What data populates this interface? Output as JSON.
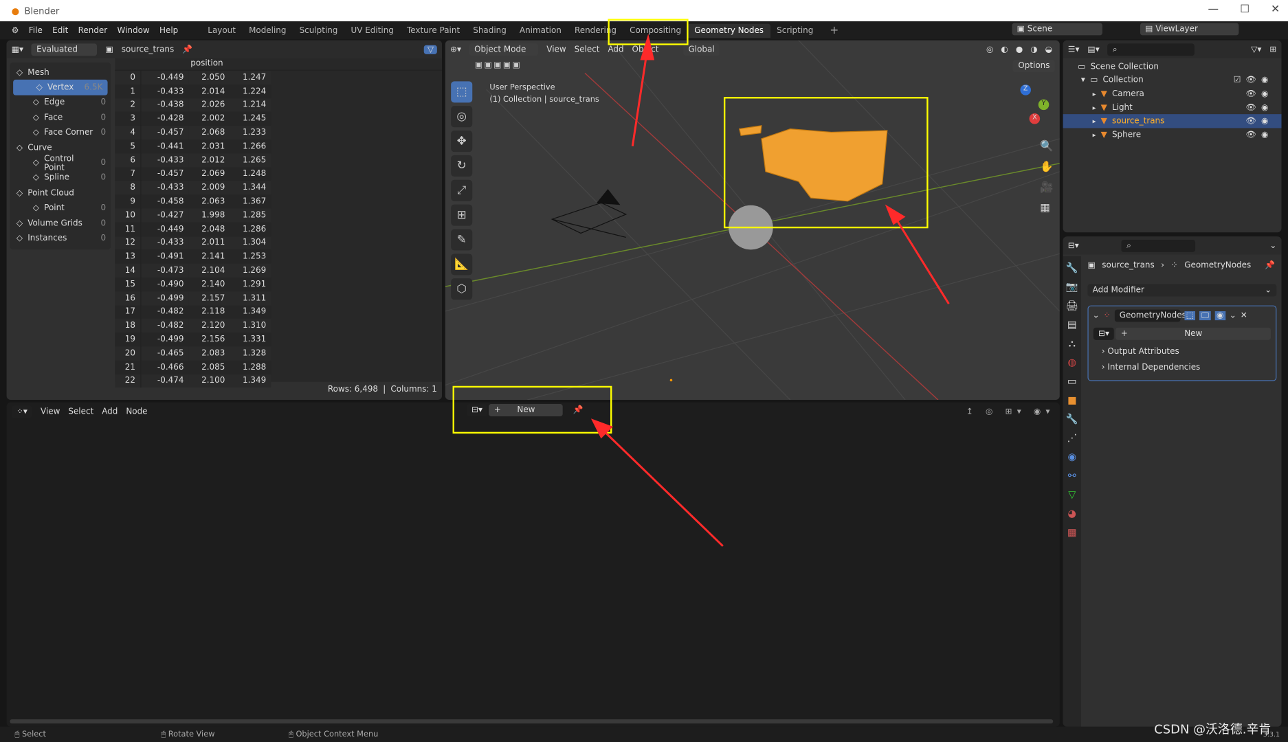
{
  "window": {
    "title": "Blender",
    "min": "—",
    "max": "☐",
    "close": "✕"
  },
  "menu": [
    "File",
    "Edit",
    "Render",
    "Window",
    "Help"
  ],
  "workspaces": [
    "Layout",
    "Modeling",
    "Sculpting",
    "UV Editing",
    "Texture Paint",
    "Shading",
    "Animation",
    "Rendering",
    "Compositing",
    "Geometry Nodes",
    "Scripting"
  ],
  "active_workspace": "Geometry Nodes",
  "add_workspace": "+",
  "scene": "Scene",
  "view_layer": "ViewLayer",
  "spreadsheet": {
    "mode": "Evaluated",
    "object": "source_trans",
    "column_header": "position",
    "domains": [
      {
        "label": "Mesh",
        "count": "",
        "sub": false,
        "icon": "mesh-icon"
      },
      {
        "label": "Vertex",
        "count": "6.5K",
        "sub": true,
        "selected": true,
        "icon": "vertex-icon"
      },
      {
        "label": "Edge",
        "count": "0",
        "sub": true,
        "icon": "edge-icon"
      },
      {
        "label": "Face",
        "count": "0",
        "sub": true,
        "icon": "face-icon"
      },
      {
        "label": "Face Corner",
        "count": "0",
        "sub": true,
        "icon": "face-corner-icon"
      },
      {
        "label": "Curve",
        "count": "",
        "sub": false,
        "icon": "curve-icon"
      },
      {
        "label": "Control Point",
        "count": "0",
        "sub": true,
        "icon": "control-point-icon"
      },
      {
        "label": "Spline",
        "count": "0",
        "sub": true,
        "icon": "spline-icon"
      },
      {
        "label": "Point Cloud",
        "count": "",
        "sub": false,
        "icon": "point-cloud-icon"
      },
      {
        "label": "Point",
        "count": "0",
        "sub": true,
        "icon": "point-icon"
      },
      {
        "label": "Volume Grids",
        "count": "0",
        "sub": false,
        "icon": "volume-icon"
      },
      {
        "label": "Instances",
        "count": "0",
        "sub": false,
        "icon": "instances-icon"
      }
    ],
    "rows": [
      [
        "0",
        "-0.449",
        "2.050",
        "1.247"
      ],
      [
        "1",
        "-0.433",
        "2.014",
        "1.224"
      ],
      [
        "2",
        "-0.438",
        "2.026",
        "1.214"
      ],
      [
        "3",
        "-0.428",
        "2.002",
        "1.245"
      ],
      [
        "4",
        "-0.457",
        "2.068",
        "1.233"
      ],
      [
        "5",
        "-0.441",
        "2.031",
        "1.266"
      ],
      [
        "6",
        "-0.433",
        "2.012",
        "1.265"
      ],
      [
        "7",
        "-0.457",
        "2.069",
        "1.248"
      ],
      [
        "8",
        "-0.433",
        "2.009",
        "1.344"
      ],
      [
        "9",
        "-0.458",
        "2.063",
        "1.367"
      ],
      [
        "10",
        "-0.427",
        "1.998",
        "1.285"
      ],
      [
        "11",
        "-0.449",
        "2.048",
        "1.286"
      ],
      [
        "12",
        "-0.433",
        "2.011",
        "1.304"
      ],
      [
        "13",
        "-0.491",
        "2.141",
        "1.253"
      ],
      [
        "14",
        "-0.473",
        "2.104",
        "1.269"
      ],
      [
        "15",
        "-0.490",
        "2.140",
        "1.291"
      ],
      [
        "16",
        "-0.499",
        "2.157",
        "1.311"
      ],
      [
        "17",
        "-0.482",
        "2.118",
        "1.349"
      ],
      [
        "18",
        "-0.482",
        "2.120",
        "1.310"
      ],
      [
        "19",
        "-0.499",
        "2.156",
        "1.331"
      ],
      [
        "20",
        "-0.465",
        "2.083",
        "1.328"
      ],
      [
        "21",
        "-0.466",
        "2.085",
        "1.288"
      ],
      [
        "22",
        "-0.474",
        "2.100",
        "1.349"
      ]
    ],
    "rows_label": "Rows: 6,498",
    "columns_label": "Columns: 1"
  },
  "viewport": {
    "mode": "Object Mode",
    "menu": [
      "View",
      "Select",
      "Add",
      "Object"
    ],
    "orientation": "Global",
    "options": "Options",
    "perspective": "User Perspective",
    "collection_info": "(1) Collection | source_trans",
    "axes": [
      "X",
      "Y",
      "Z"
    ]
  },
  "outliner": {
    "scene_collection": "Scene Collection",
    "collection": "Collection",
    "items": [
      {
        "name": "Camera",
        "icon": "camera-icon"
      },
      {
        "name": "Light",
        "icon": "light-icon"
      },
      {
        "name": "source_trans",
        "icon": "mesh-object-icon",
        "selected": true
      },
      {
        "name": "Sphere",
        "icon": "mesh-object-icon"
      }
    ]
  },
  "properties": {
    "object": "source_trans",
    "modifier_path": "GeometryNodes",
    "add_modifier": "Add Modifier",
    "modifier_name": "GeometryNodes",
    "new": "New",
    "panels": [
      "Output Attributes",
      "Internal Dependencies"
    ]
  },
  "node_editor": {
    "menu": [
      "View",
      "Select",
      "Add",
      "Node"
    ],
    "new": "New",
    "plus": "+"
  },
  "status": {
    "items": [
      "Select",
      "Rotate View",
      "Object Context Menu"
    ],
    "version": "3.3.1"
  },
  "watermark": "CSDN @沃洛德.辛肯",
  "colors": {
    "accent": "#4772b3",
    "highlight_box": "#ffff00",
    "arrow": "#ff2a2a",
    "selected_text": "#ffaf29"
  }
}
